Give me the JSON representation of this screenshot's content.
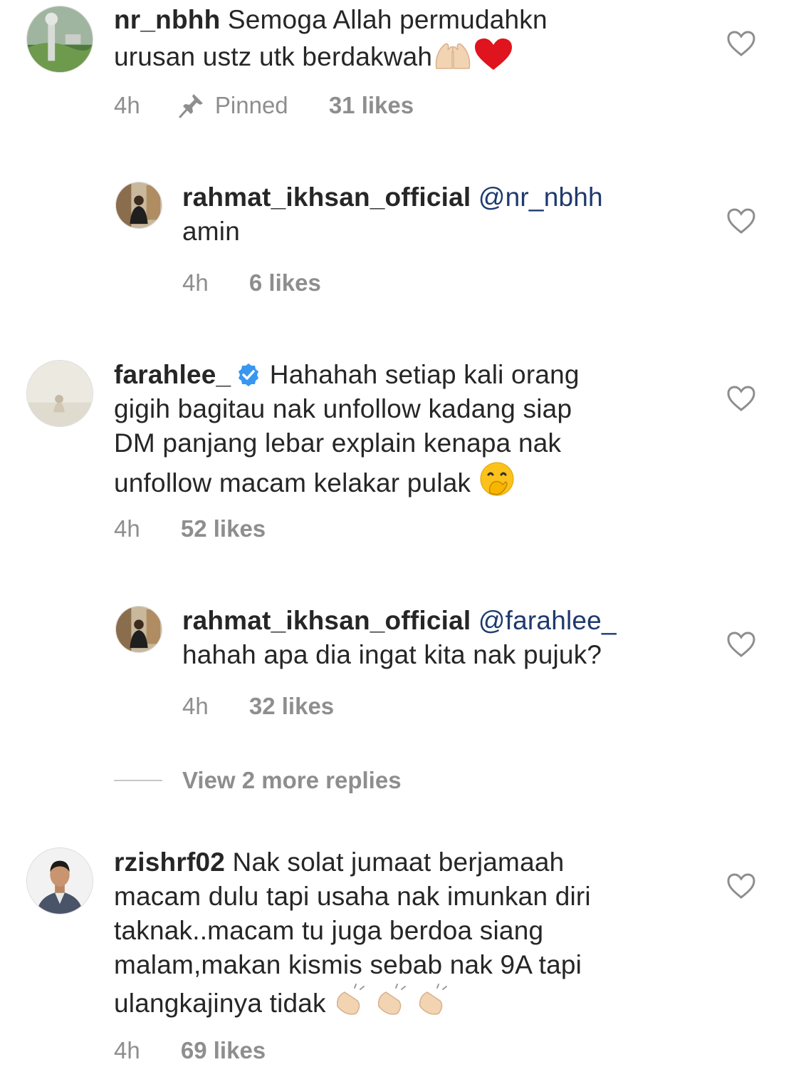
{
  "comments": [
    {
      "username": "nr_nbhh",
      "text_line1": "Semoga Allah permudahkn",
      "text_line2": "urusan ustz utk berdakwah",
      "time": "4h",
      "pinned_label": "Pinned",
      "likes": "31 likes"
    },
    {
      "username": "rahmat_ikhsan_official",
      "mention": "@nr_nbhh",
      "text": "amin",
      "time": "4h",
      "likes": "6 likes"
    },
    {
      "username": "farahlee_",
      "text_line1": "Hahahah setiap kali orang",
      "text_line2": "gigih bagitau nak unfollow kadang siap",
      "text_line3": "DM panjang lebar explain kenapa nak",
      "text_line4": "unfollow macam kelakar pulak",
      "time": "4h",
      "likes": "52 likes"
    },
    {
      "username": "rahmat_ikhsan_official",
      "mention": "@farahlee_",
      "text": "hahah apa dia ingat kita nak pujuk?",
      "time": "4h",
      "likes": "32 likes"
    },
    {
      "username": "rzishrf02",
      "text_line1": "Nak solat jumaat berjamaah",
      "text_line2": "macam dulu tapi usaha nak imunkan diri",
      "text_line3": "taknak..macam tu juga berdoa siang",
      "text_line4": "malam,makan kismis sebab nak 9A tapi",
      "text_line5": "ulangkajinya tidak",
      "time": "4h",
      "likes": "69 likes"
    }
  ],
  "view_more": "View 2 more replies",
  "icons": {
    "heart": "heart-outline-icon",
    "pin": "pin-icon",
    "verified": "verified-badge-icon"
  },
  "colors": {
    "text": "#262626",
    "meta": "#8e8e8e",
    "mention": "#1e3a6e",
    "verified": "#3897f0"
  }
}
